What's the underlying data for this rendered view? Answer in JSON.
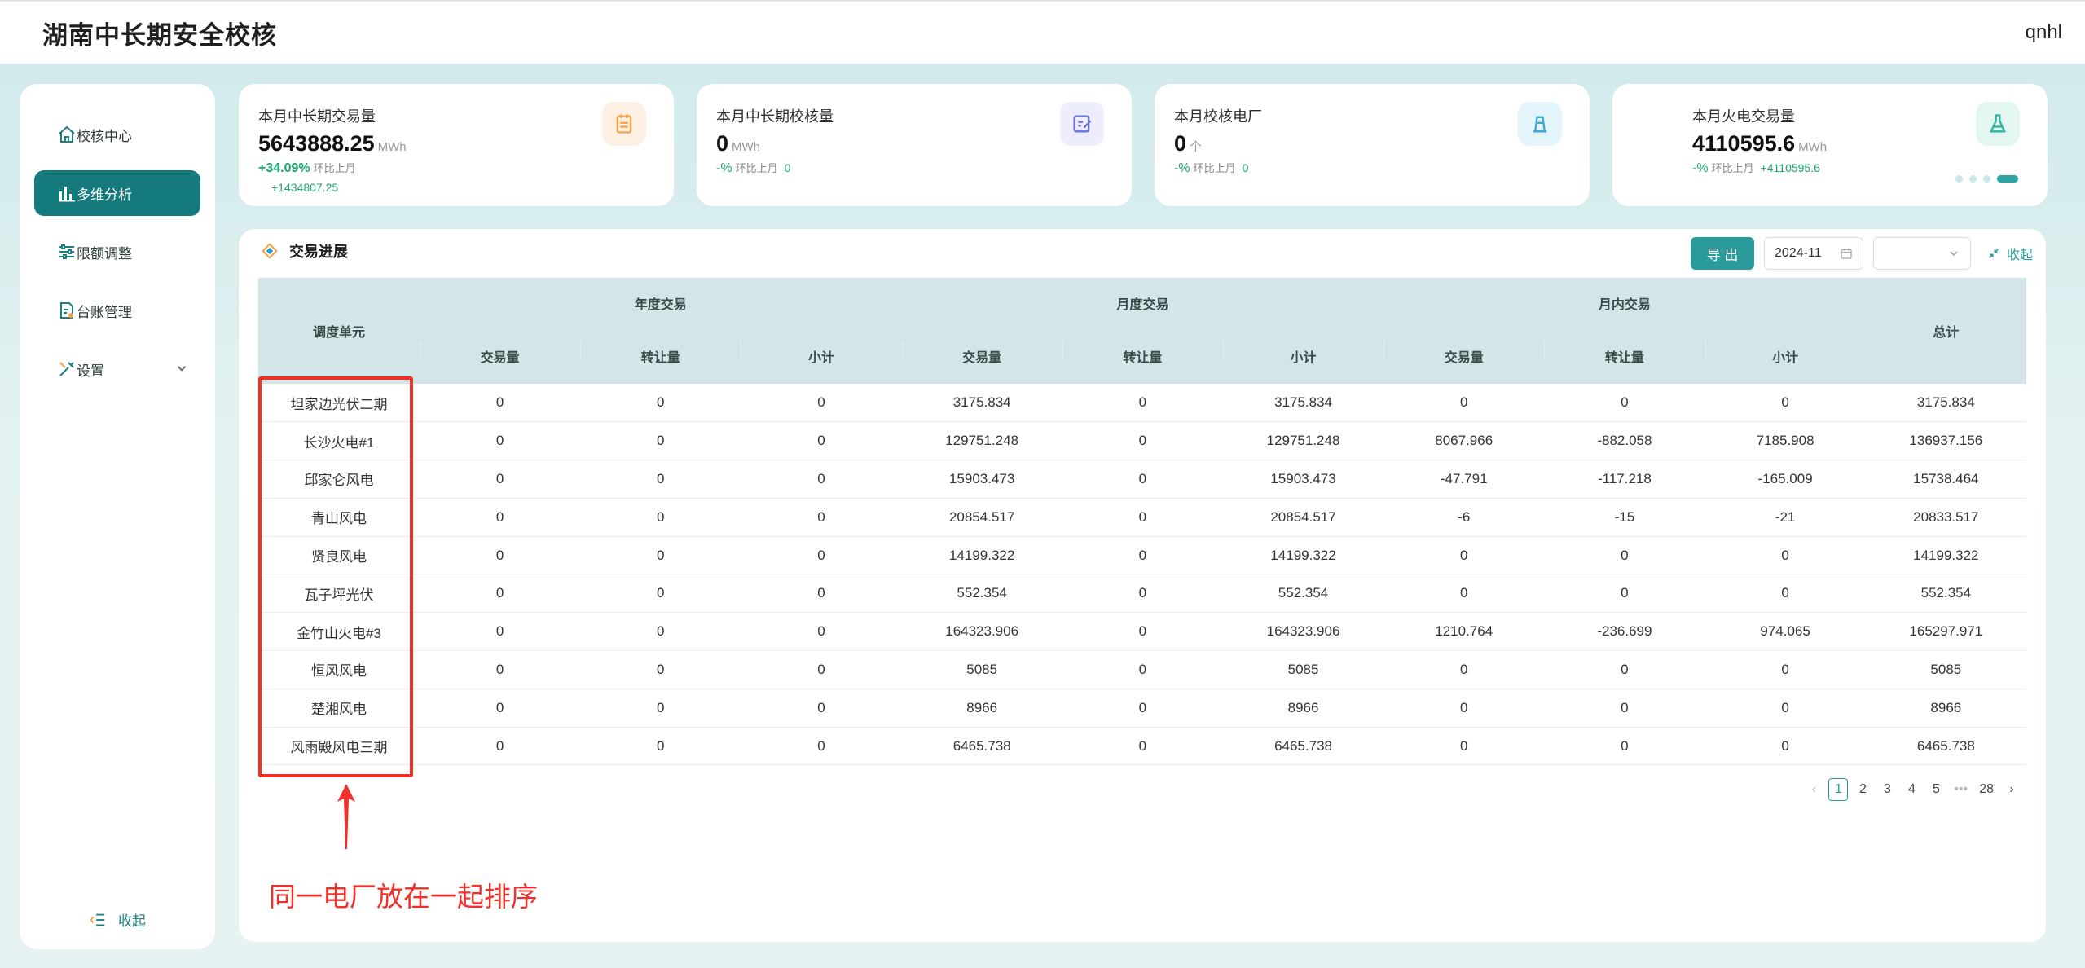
{
  "app": {
    "title": "湖南中长期安全校核",
    "user": "qnhl"
  },
  "sidebar": {
    "items": [
      {
        "label": "校核中心",
        "icon": "home-icon",
        "active": false
      },
      {
        "label": "多维分析",
        "icon": "bar-chart-icon",
        "active": true
      },
      {
        "label": "限额调整",
        "icon": "sliders-icon",
        "active": false
      },
      {
        "label": "台账管理",
        "icon": "document-icon",
        "active": false
      },
      {
        "label": "设置",
        "icon": "tools-icon",
        "active": false
      }
    ],
    "collapse_label": "收起"
  },
  "cards": [
    {
      "title": "本月中长期交易量",
      "value": "5643888.25",
      "unit": "MWh",
      "change": "+34.09%",
      "change_label": "环比上月",
      "diff": "+1434807.25",
      "icon": "clipboard-icon",
      "icon_color": "#f5a24a",
      "icon_bg": "#fdf0e2"
    },
    {
      "title": "本月中长期校核量",
      "value": "0",
      "unit": "MWh",
      "change": "-%",
      "change_label": "环比上月",
      "diff": "0",
      "icon": "edit-doc-icon",
      "icon_color": "#6b72e0",
      "icon_bg": "#eceefe"
    },
    {
      "title": "本月校核电厂",
      "value": "0",
      "unit": "个",
      "change": "-%",
      "change_label": "环比上月",
      "diff": "0",
      "icon": "power-plant-icon",
      "icon_color": "#3aa9d6",
      "icon_bg": "#e3f4fb"
    },
    {
      "title": "本月火电交易量",
      "value": "4110595.6",
      "unit": "MWh",
      "change": "-%",
      "change_label": "环比上月",
      "diff": "+4110595.6",
      "icon": "flask-icon",
      "icon_color": "#2fb59c",
      "icon_bg": "#e3f6f2"
    }
  ],
  "panel": {
    "title": "交易进展",
    "export_label": "导 出",
    "date_value": "2024-11",
    "collapse_label": "收起"
  },
  "table": {
    "unit_header": "调度单元",
    "groups": [
      "年度交易",
      "月度交易",
      "月内交易"
    ],
    "sub_headers": [
      "交易量",
      "转让量",
      "小计",
      "交易量",
      "转让量",
      "小计",
      "交易量",
      "转让量",
      "小计"
    ],
    "total_header": "总计",
    "rows": [
      [
        "坦家边光伏二期",
        "0",
        "0",
        "0",
        "3175.834",
        "0",
        "3175.834",
        "0",
        "0",
        "0",
        "3175.834"
      ],
      [
        "长沙火电#1",
        "0",
        "0",
        "0",
        "129751.248",
        "0",
        "129751.248",
        "8067.966",
        "-882.058",
        "7185.908",
        "136937.156"
      ],
      [
        "邱家仑风电",
        "0",
        "0",
        "0",
        "15903.473",
        "0",
        "15903.473",
        "-47.791",
        "-117.218",
        "-165.009",
        "15738.464"
      ],
      [
        "青山风电",
        "0",
        "0",
        "0",
        "20854.517",
        "0",
        "20854.517",
        "-6",
        "-15",
        "-21",
        "20833.517"
      ],
      [
        "贤良风电",
        "0",
        "0",
        "0",
        "14199.322",
        "0",
        "14199.322",
        "0",
        "0",
        "0",
        "14199.322"
      ],
      [
        "瓦子坪光伏",
        "0",
        "0",
        "0",
        "552.354",
        "0",
        "552.354",
        "0",
        "0",
        "0",
        "552.354"
      ],
      [
        "金竹山火电#3",
        "0",
        "0",
        "0",
        "164323.906",
        "0",
        "164323.906",
        "1210.764",
        "-236.699",
        "974.065",
        "165297.971"
      ],
      [
        "恒风风电",
        "0",
        "0",
        "0",
        "5085",
        "0",
        "5085",
        "0",
        "0",
        "0",
        "5085"
      ],
      [
        "楚湘风电",
        "0",
        "0",
        "0",
        "8966",
        "0",
        "8966",
        "0",
        "0",
        "0",
        "8966"
      ],
      [
        "风雨殿风电三期",
        "0",
        "0",
        "0",
        "6465.738",
        "0",
        "6465.738",
        "0",
        "0",
        "0",
        "6465.738"
      ]
    ]
  },
  "pagination": {
    "pages": [
      "1",
      "2",
      "3",
      "4",
      "5"
    ],
    "ellipsis": "•••",
    "last": "28",
    "current": "1"
  },
  "annotation": {
    "text": "同一电厂放在一起排序",
    "color": "#f0302a"
  },
  "colors": {
    "accent": "#157a7c",
    "button": "#2a9a9a",
    "positive": "#1ba86a",
    "table_header": "#d3e5e6"
  }
}
